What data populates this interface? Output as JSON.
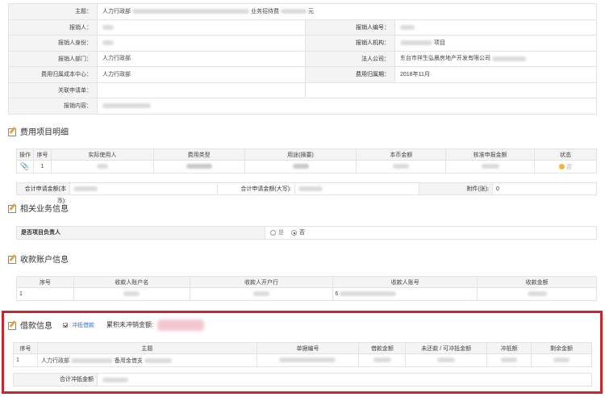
{
  "info": {
    "subject_label": "主题：",
    "subject_prefix": "人力行政部",
    "subject_middle": "业务招待费",
    "subject_suffix": "元",
    "reporter_label": "报销人：",
    "reporter_no_label": "报销人编号：",
    "reporter_id_label": "报销人身份：",
    "reporter_org_label": "报销人机构：",
    "reporter_org_suffix": "项目",
    "reporter_dept_label": "报销人部门：",
    "reporter_dept": "人力行政部",
    "legal_company_label": "法人公司：",
    "legal_company": "东台市祥生弘晨房地产开发有限公司",
    "cost_center_label": "费用归属成本中心：",
    "cost_center": "人力行政部",
    "period_label": "费用归属期：",
    "period": "2018年11月",
    "related_doc_label": "关联申请单：",
    "content_label": "报销内容："
  },
  "expense_section": {
    "title": "费用项目明细",
    "headers": [
      "操作",
      "序号",
      "实际使用人",
      "费用类型",
      "用途(摘要)",
      "本币金额",
      "核准申报金额",
      "状态"
    ],
    "row_no": "1",
    "status_text": "否",
    "total_rmb_label": "合计申请金额(本币):",
    "total_upper_label": "合计申请金额(大写):",
    "attachments_label": "附件(张):",
    "attachments": "0"
  },
  "business_section": {
    "title": "相关业务信息",
    "project_head_label": "是否项目负责人",
    "yes": "是",
    "no": "否"
  },
  "account_section": {
    "title": "收款账户信息",
    "headers": [
      "序号",
      "收款人账户名",
      "收款人开户行",
      "收款人账号",
      "收款金额"
    ],
    "row_no": "1",
    "account_prefix": "6"
  },
  "loan_section": {
    "title": "借款信息",
    "offset_label": "冲抵借款",
    "accum_label": "累积未冲销金额:",
    "headers": [
      "序号",
      "主题",
      "单据编号",
      "借款金额",
      "未还款 / 可冲抵金额",
      "冲抵额",
      "剩余金额"
    ],
    "row_no": "1",
    "row_subject_prefix": "人力行政部",
    "row_subject_middle": "备用金借支",
    "total_offset_label": "合计冲抵金额"
  }
}
